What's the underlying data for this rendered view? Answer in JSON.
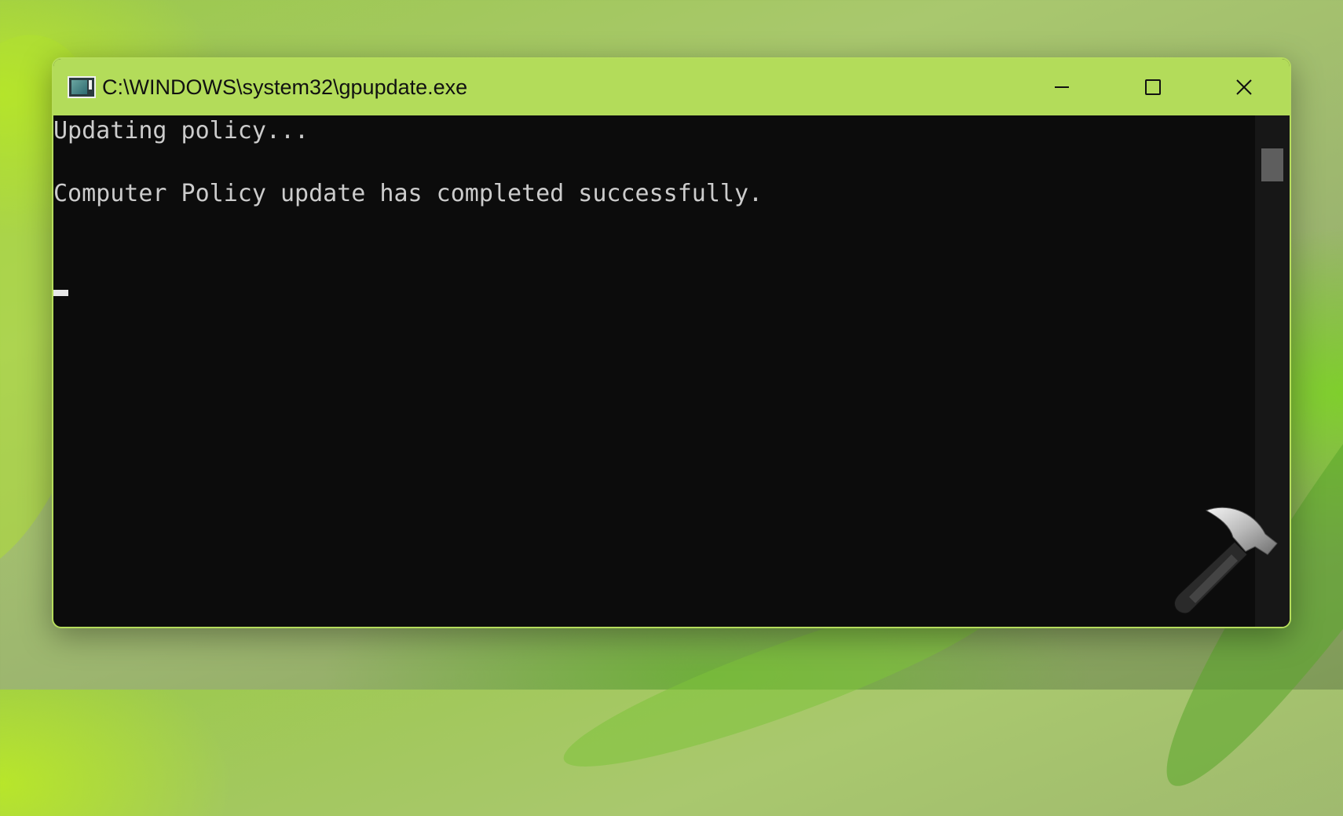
{
  "window": {
    "title": "C:\\WINDOWS\\system32\\gpupdate.exe",
    "icon": "console-app-icon",
    "controls": [
      "minimize-icon",
      "maximize-icon",
      "close-icon"
    ]
  },
  "console": {
    "lines": [
      "Updating policy...",
      "Computer Policy update has completed successfully."
    ],
    "text_color": "#cccccc",
    "background": "#0c0c0c"
  },
  "titlebar_color": "#b3dc5a",
  "watermark_icon": "hammer-icon"
}
